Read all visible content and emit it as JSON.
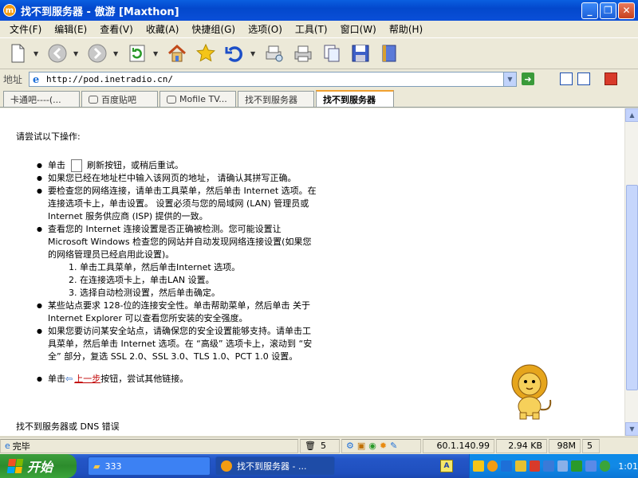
{
  "window": {
    "title": "找不到服务器 - 傲游 [Maxthon]",
    "icon_letter": "m",
    "minimize": "_",
    "maximize": "❐",
    "close": "✕"
  },
  "menu": [
    "文件(F)",
    "编辑(E)",
    "查看(V)",
    "收藏(A)",
    "快捷组(G)",
    "选项(O)",
    "工具(T)",
    "窗口(W)",
    "帮助(H)"
  ],
  "address": {
    "label": "地址",
    "url": "http://pod.inetradio.cn/"
  },
  "tabs": [
    {
      "label": "卡通吧----(..."
    },
    {
      "label": "百度贴吧"
    },
    {
      "label": "Mofile TV..."
    },
    {
      "label": "找不到服务器"
    },
    {
      "label": "找不到服务器",
      "active": true
    }
  ],
  "page": {
    "lead": "请尝试以下操作:",
    "bullets": [
      {
        "pre": "单击",
        "post": "刷新按钮，或稍后重试。"
      },
      {
        "text": "如果您已经在地址栏中输入该网页的地址， 请确认其拼写正确。"
      },
      {
        "text": "要检查您的网络连接，请单击工具菜单，然后单击 Internet 选项。在连接选项卡上，单击设置。 设置必须与您的局域网 (LAN) 管理员或 Internet 服务供应商 (ISP) 提供的一致。"
      },
      {
        "text": "查看您的 Internet 连接设置是否正确被检测。您可能设置让 Microsoft Windows 检查您的网站并自动发现网络连接设置(如果您的网络管理员已经启用此设置)。",
        "steps": [
          "1.  单击工具菜单，然后单击Internet 选项。",
          "2.  在连接选项卡上，单击LAN 设置。",
          "3.  选择自动检测设置，然后单击确定。"
        ]
      },
      {
        "text": "某些站点要求 128-位的连接安全性。单击帮助菜单，然后单击 关于 Internet Explorer 可以查看您所安装的安全强度。"
      },
      {
        "text": "如果您要访问某安全站点，请确保您的安全设置能够支持。请单击工具菜单，然后单击 Internet 选项。在 “高级” 选项卡上，滚动到 “安全” 部分，复选 SSL 2.0、SSL 3.0、TLS 1.0、PCT 1.0 设置。"
      },
      {
        "pre": "单击",
        "link": "上一步",
        "post": "按钮，尝试其他链接。"
      }
    ],
    "footer": "找不到服务器或 DNS 错误"
  },
  "status": {
    "text": "完毕",
    "count": "5",
    "ip": "60.1.140.99",
    "speed": "2.94 KB",
    "memory": "98M",
    "page_count": "5"
  },
  "taskbar": {
    "start": "开始",
    "tasks": [
      {
        "label": "333"
      },
      {
        "label": "找不到服务器 - ...",
        "active": true
      }
    ],
    "clock": "1:01"
  }
}
